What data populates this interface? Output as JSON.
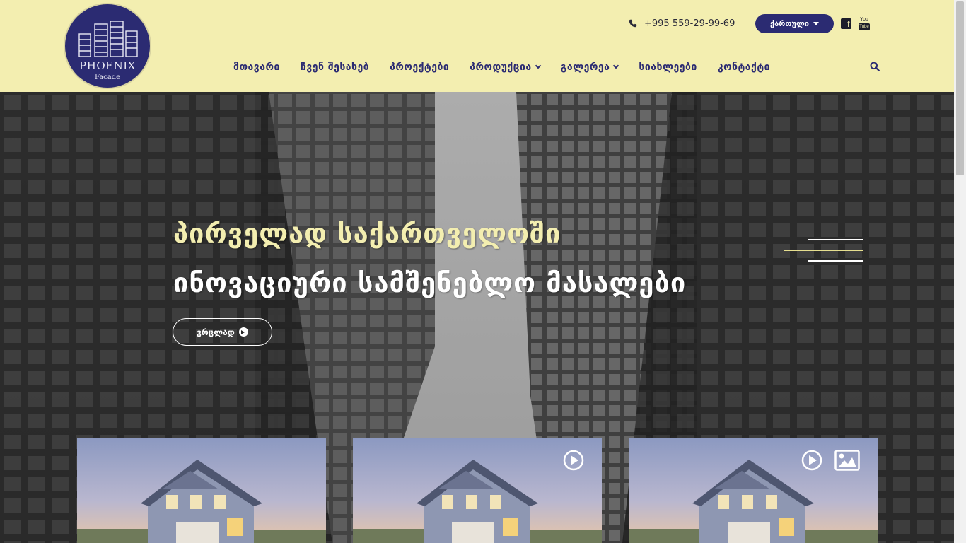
{
  "header": {
    "logo": {
      "title": "PHOENIX",
      "subtitle": "Facade"
    },
    "phone": "+995 559-29-99-69",
    "language_button": "ქართული",
    "social": [
      "facebook-icon",
      "youtube-icon"
    ],
    "youtube_text": {
      "top": "You",
      "bottom": "Tube"
    }
  },
  "nav": {
    "items": [
      {
        "label": "მთავარი",
        "dropdown": false
      },
      {
        "label": "ჩვენ შესახებ",
        "dropdown": false
      },
      {
        "label": "პროექტები",
        "dropdown": false
      },
      {
        "label": "პროდუქცია",
        "dropdown": true
      },
      {
        "label": "გალერეა",
        "dropdown": true
      },
      {
        "label": "სიახლეები",
        "dropdown": false
      },
      {
        "label": "კონტაქტი",
        "dropdown": false
      }
    ],
    "search_icon": "search-icon"
  },
  "hero": {
    "title_line1": "პირველად საქართველოში",
    "title_line2": "ინოვაციური სამშენებლო მასალები",
    "button_label": "ვრცლად"
  },
  "cards": [
    {
      "icons": []
    },
    {
      "icons": [
        "play-icon"
      ]
    },
    {
      "icons": [
        "play-icon",
        "image-icon"
      ]
    }
  ],
  "colors": {
    "header_bg": "#f3eeb0",
    "brand_navy": "#2b2b72",
    "accent_yellow": "#f3eeb0"
  }
}
